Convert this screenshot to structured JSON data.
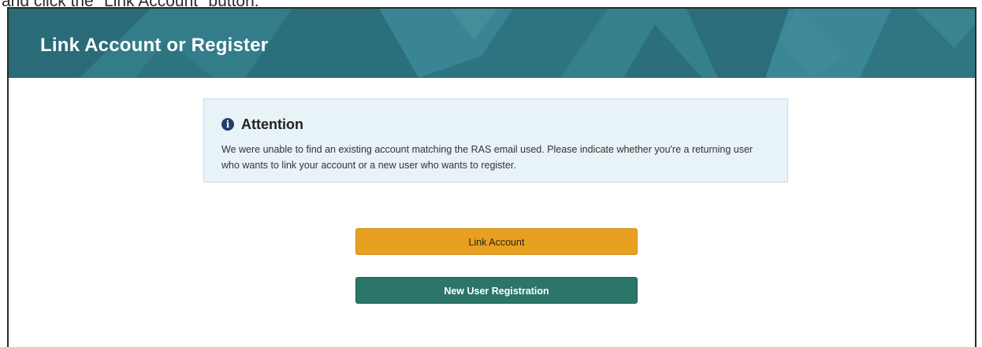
{
  "caption": "and click the \"Link Account\" button.",
  "header": {
    "title": "Link Account or Register"
  },
  "alert": {
    "icon": "info-circle-icon",
    "title": "Attention",
    "message": "We were unable to find an existing account matching the RAS email used. Please indicate whether you're a returning user who wants to link your account or a new user who wants to register."
  },
  "actions": {
    "link_label": "Link Account",
    "register_label": "New User Registration"
  },
  "colors": {
    "banner": "#2f7482",
    "link_button": "#e8a021",
    "register_button": "#2b7569",
    "alert_background": "#e8f3f7",
    "info_icon": "#1e3f66"
  }
}
